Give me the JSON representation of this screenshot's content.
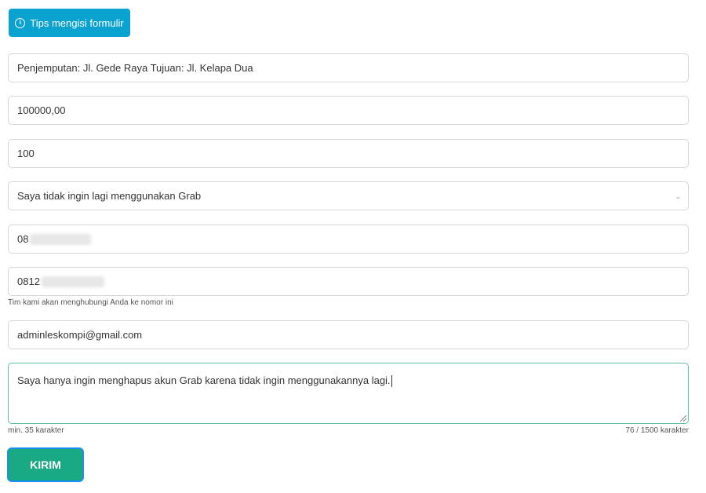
{
  "tips_button": {
    "label": "Tips mengisi formulir",
    "icon": "info-icon"
  },
  "fields": {
    "route": {
      "value": "Penjemputan: Jl. Gede Raya Tujuan: Jl. Kelapa Dua"
    },
    "amount": {
      "value": "100000,00"
    },
    "percent": {
      "value": "100"
    },
    "reason": {
      "value": "Saya tidak ingin lagi menggunakan Grab",
      "icon": "chevron-down-icon"
    },
    "phone1": {
      "value": "08"
    },
    "phone2": {
      "value": "0812",
      "helper": "Tim kami akan menghubungi Anda ke nomor ini"
    },
    "email": {
      "value": "adminleskompi@gmail.com"
    },
    "message": {
      "value": "Saya hanya ingin menghapus akun Grab karena tidak ingin menggunakannya lagi.",
      "min_label": "min. 35 karakter",
      "counter": "76 / 1500 karakter"
    }
  },
  "submit": {
    "label": "KIRIM"
  },
  "colors": {
    "tips": "#0aa3cf",
    "submit": "#19a983",
    "focus_border": "#5cc1a1"
  }
}
